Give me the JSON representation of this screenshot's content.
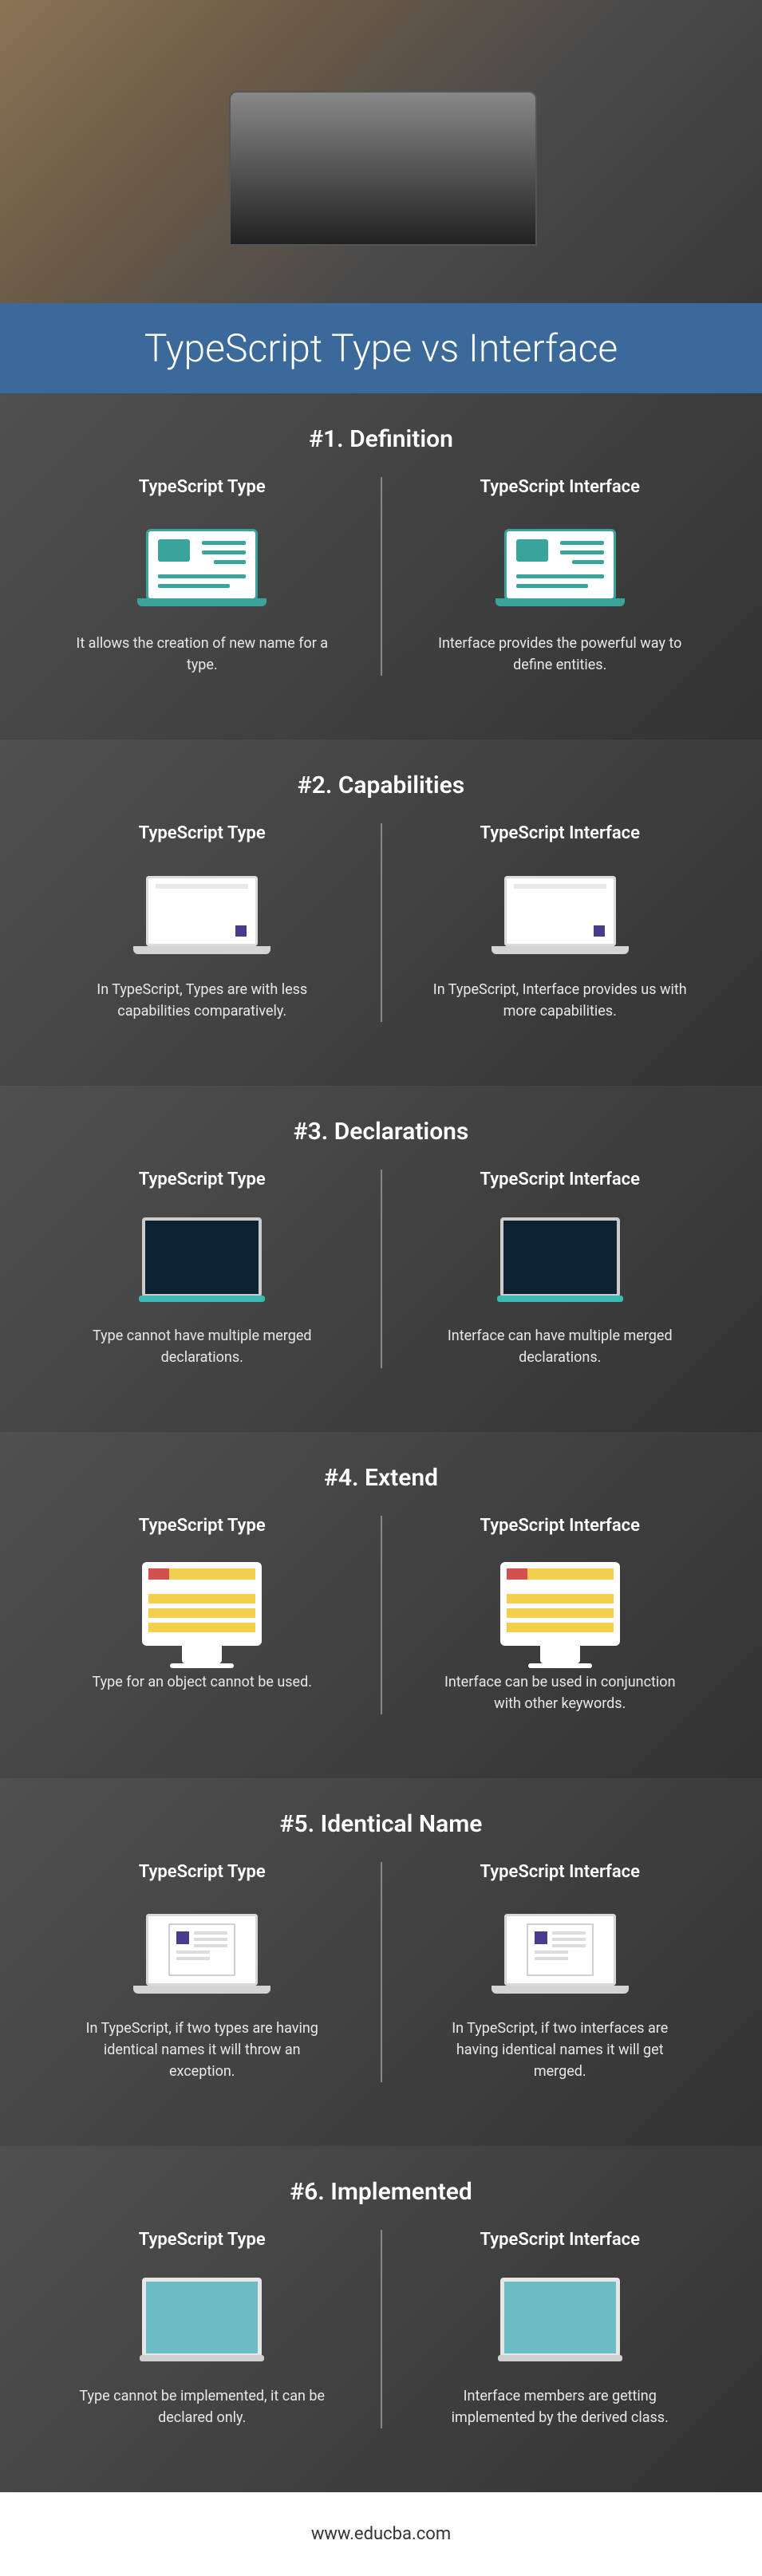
{
  "title": "TypeScript Type vs Interface",
  "footer": "www.educba.com",
  "sections": [
    {
      "heading": "#1. Definition",
      "left_title": "TypeScript Type",
      "right_title": "TypeScript Interface",
      "left_desc": "It allows the creation of new name for a type.",
      "right_desc": "Interface provides the powerful way to define entities.",
      "icon": "laptop-a"
    },
    {
      "heading": "#2. Capabilities",
      "left_title": "TypeScript Type",
      "right_title": "TypeScript Interface",
      "left_desc": "In TypeScript, Types are with less capabilities comparatively.",
      "right_desc": "In TypeScript, Interface provides us with more capabilities.",
      "icon": "laptop-b"
    },
    {
      "heading": "#3. Declarations",
      "left_title": "TypeScript Type",
      "right_title": "TypeScript Interface",
      "left_desc": "Type cannot have multiple merged declarations.",
      "right_desc": "Interface can have multiple merged declarations.",
      "icon": "monitor-d"
    },
    {
      "heading": "#4. Extend",
      "left_title": "TypeScript Type",
      "right_title": "TypeScript Interface",
      "left_desc": "Type for an object cannot be used.",
      "right_desc": "Interface can be used in conjunction with other keywords.",
      "icon": "monitor-w"
    },
    {
      "heading": "#5. Identical Name",
      "left_title": "TypeScript Type",
      "right_title": "TypeScript Interface",
      "left_desc": "In TypeScript, if two types are having identical names it will throw an exception.",
      "right_desc": "In TypeScript, if two interfaces are having identical names it will get merged.",
      "icon": "laptop-c"
    },
    {
      "heading": "#6. Implemented",
      "left_title": "TypeScript Type",
      "right_title": "TypeScript Interface",
      "left_desc": "Type cannot be implemented, it can be declared only.",
      "right_desc": "Interface members are getting implemented by the derived class.",
      "icon": "monitor-c"
    }
  ]
}
